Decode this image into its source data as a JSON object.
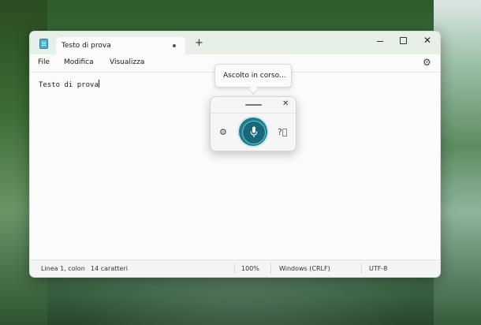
{
  "window": {
    "tab_title": "Testo di prova",
    "new_tab_glyph": "+",
    "close_glyph": "✕"
  },
  "menu": {
    "file": "File",
    "edit": "Modifica",
    "view": "Visualizza",
    "settings_icon": "gear-icon"
  },
  "editor": {
    "content": "Testo di prova"
  },
  "status": {
    "position": "Linea 1, colon",
    "chars": "14 caratteri",
    "zoom": "100%",
    "line_ending": "Windows (CRLF)",
    "encoding": "UTF-8"
  },
  "voice": {
    "tooltip": "Ascolto in corso...",
    "close_glyph": "✕",
    "settings_icon": "gear-icon",
    "mic_icon": "microphone-icon",
    "help_icon": "help-icon",
    "accent": "#1f7d8e"
  }
}
